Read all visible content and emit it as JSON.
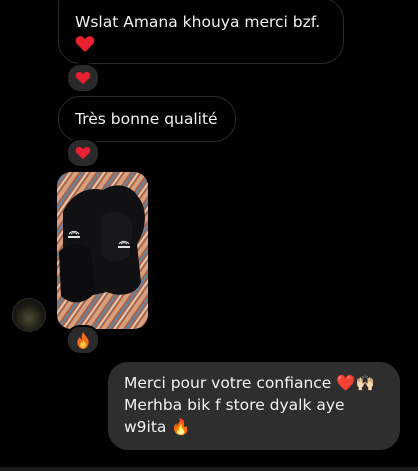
{
  "messages": {
    "m1_line1": "Wslat Amana khouya merci bzf.",
    "m1_line2_emoji": "❤️",
    "m1_reaction": "❤️",
    "m2_text": "Très bonne qualité",
    "m2_reaction": "❤️",
    "photo_reaction": "🔥",
    "reply_line1": "Merci pour votre confiance ❤️🙌🏻",
    "reply_line2": "Merhba bik f store  dyalk aye",
    "reply_line3": "w9ita 🔥"
  },
  "icons": {
    "heart": "heart-icon",
    "fire": "fire-icon"
  },
  "colors": {
    "background": "#000000",
    "incoming_border": "#2b2b2b",
    "outgoing_bubble": "#2e2e2e",
    "heart": "#e8202f",
    "text": "#f2f2f2"
  }
}
